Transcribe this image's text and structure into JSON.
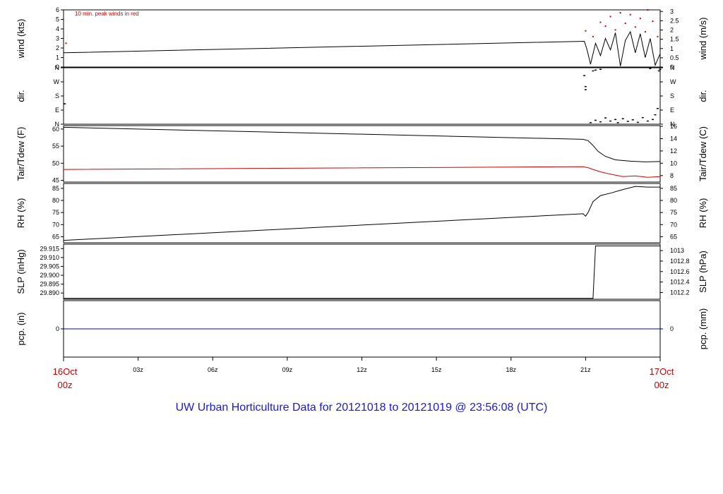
{
  "title": "UW Urban Horticulture Data for 20121018  to  20121019 @ 23:56:08  (UTC)",
  "colors": {
    "trace": "#000000",
    "red": "#cc0000",
    "blue": "#1a1ad6",
    "precip": "#0000cc"
  },
  "chart_data": {
    "type": "line",
    "x_axis": {
      "tick_labels": [
        "03z",
        "06z",
        "09z",
        "12z",
        "15z",
        "18z",
        "21z"
      ],
      "tick_hours": [
        3,
        6,
        9,
        12,
        15,
        18,
        21
      ],
      "start_label": [
        "16Oct",
        "00z"
      ],
      "end_label": [
        "17Oct",
        "00z"
      ],
      "range_hours": [
        0,
        24
      ]
    },
    "panels": [
      {
        "id": "wind",
        "left_label": "wind (kts)",
        "right_label": "wind (m/s)",
        "left_ticks": [
          "0",
          "1",
          "2",
          "3",
          "4",
          "5",
          "6"
        ],
        "left_tick_values": [
          0,
          1,
          2,
          3,
          4,
          5,
          6
        ],
        "right_ticks": [
          "0",
          "0.5",
          "1",
          "1.5",
          "2",
          "2.5",
          "3"
        ],
        "right_tick_values": [
          0,
          0.5,
          1,
          1.5,
          2,
          2.5,
          3
        ],
        "ylim": [
          0,
          6
        ],
        "annotation": "10 min. peak winds in red",
        "series": [
          {
            "style": "line",
            "color": "#000000",
            "points": [
              [
                0,
                1.5
              ],
              [
                20.95,
                2.7
              ],
              [
                21.05,
                1.9
              ],
              [
                21.2,
                0.3
              ],
              [
                21.4,
                2.5
              ],
              [
                21.6,
                1.2
              ],
              [
                21.8,
                3.0
              ],
              [
                22.0,
                1.8
              ],
              [
                22.2,
                3.6
              ],
              [
                22.4,
                0.1
              ],
              [
                22.6,
                2.8
              ],
              [
                22.8,
                3.7
              ],
              [
                23.0,
                1.5
              ],
              [
                23.2,
                3.5
              ],
              [
                23.4,
                1.0
              ],
              [
                23.6,
                3.0
              ],
              [
                23.8,
                0.2
              ],
              [
                24,
                1.4
              ]
            ]
          },
          {
            "style": "points",
            "color": "#cc0000",
            "points": [
              [
                0.1,
                2.5
              ],
              [
                21.0,
                3.8
              ],
              [
                21.3,
                3.2
              ],
              [
                21.6,
                4.7
              ],
              [
                21.8,
                4.3
              ],
              [
                22.0,
                5.3
              ],
              [
                22.2,
                3.9
              ],
              [
                22.4,
                5.7
              ],
              [
                22.6,
                4.6
              ],
              [
                22.8,
                5.5
              ],
              [
                23.0,
                4.2
              ],
              [
                23.2,
                5.1
              ],
              [
                23.4,
                3.7
              ],
              [
                23.5,
                6.0
              ],
              [
                23.7,
                4.8
              ],
              [
                23.9,
                3.2
              ]
            ]
          }
        ]
      },
      {
        "id": "dir",
        "left_label": "dir.",
        "right_label": "dir.",
        "left_ticks": [
          "N",
          "E",
          "S",
          "W",
          "N"
        ],
        "left_tick_values": [
          0,
          90,
          180,
          270,
          360
        ],
        "right_ticks": [
          "N",
          "E",
          "S",
          "W",
          "N"
        ],
        "right_tick_values": [
          0,
          90,
          180,
          270,
          360
        ],
        "ylim": [
          0,
          360
        ],
        "series": [
          {
            "style": "dashes",
            "color": "#000000",
            "points": [
              [
                0.05,
                130
              ],
              [
                20.95,
                310
              ],
              [
                21.0,
                240
              ],
              [
                21.0,
                220
              ],
              [
                21.3,
                340
              ],
              [
                21.4,
                345
              ],
              [
                21.6,
                350
              ],
              [
                21.2,
                10
              ],
              [
                21.4,
                25
              ],
              [
                21.6,
                15
              ],
              [
                21.8,
                40
              ],
              [
                22.0,
                20
              ],
              [
                22.2,
                30
              ],
              [
                22.3,
                10
              ],
              [
                22.5,
                35
              ],
              [
                22.7,
                18
              ],
              [
                22.9,
                28
              ],
              [
                23.1,
                12
              ],
              [
                23.3,
                42
              ],
              [
                23.5,
                20
              ],
              [
                23.6,
                355
              ],
              [
                23.7,
                30
              ],
              [
                23.8,
                60
              ],
              [
                23.9,
                100
              ],
              [
                23.95,
                340
              ],
              [
                24,
                350
              ]
            ]
          }
        ]
      },
      {
        "id": "temp",
        "left_label": "Tair/Tdew (F)",
        "right_label": "Tair/Tdew (C)",
        "left_ticks": [
          "45",
          "50",
          "55",
          "60"
        ],
        "left_tick_values": [
          45,
          50,
          55,
          60
        ],
        "right_ticks": [
          "8",
          "10",
          "12",
          "14",
          "16"
        ],
        "right_tick_values": [
          8,
          10,
          12,
          14,
          16
        ],
        "ylim": [
          44.5,
          61
        ],
        "series": [
          {
            "style": "line",
            "color": "#000000",
            "points": [
              [
                0,
                60.5
              ],
              [
                20.9,
                57
              ],
              [
                21.1,
                56.6
              ],
              [
                21.3,
                55.2
              ],
              [
                21.5,
                53.5
              ],
              [
                21.8,
                52.0
              ],
              [
                22.2,
                51.0
              ],
              [
                22.8,
                50.6
              ],
              [
                23.4,
                50.4
              ],
              [
                24,
                50.5
              ]
            ]
          },
          {
            "style": "line",
            "color": "#cc0000",
            "points": [
              [
                0,
                48.2
              ],
              [
                20.9,
                49.0
              ],
              [
                21.1,
                48.7
              ],
              [
                21.3,
                48.2
              ],
              [
                21.6,
                47.5
              ],
              [
                22.0,
                46.8
              ],
              [
                22.5,
                46.1
              ],
              [
                23.0,
                46.3
              ],
              [
                23.5,
                45.9
              ],
              [
                24,
                46.1
              ]
            ]
          }
        ]
      },
      {
        "id": "rh",
        "left_label": "RH (%)",
        "right_label": "RH (%)",
        "left_ticks": [
          "65",
          "70",
          "75",
          "80",
          "85"
        ],
        "left_tick_values": [
          65,
          70,
          75,
          80,
          85
        ],
        "right_ticks": [
          "65",
          "70",
          "75",
          "80",
          "85"
        ],
        "right_tick_values": [
          65,
          70,
          75,
          80,
          85
        ],
        "ylim": [
          62.5,
          87
        ],
        "series": [
          {
            "style": "line",
            "color": "#000000",
            "points": [
              [
                0,
                63.5
              ],
              [
                20.9,
                74.5
              ],
              [
                21.0,
                73.5
              ],
              [
                21.1,
                75.0
              ],
              [
                21.3,
                79.5
              ],
              [
                21.6,
                82.0
              ],
              [
                22.0,
                83.0
              ],
              [
                22.5,
                84.5
              ],
              [
                23.0,
                85.8
              ],
              [
                23.5,
                85.5
              ],
              [
                24,
                85.5
              ]
            ]
          }
        ]
      },
      {
        "id": "slp",
        "left_label": "SLP (inHg)",
        "right_label": "SLP (hPa)",
        "left_ticks": [
          "29.890",
          "29.895",
          "29.900",
          "29.905",
          "29.910",
          "29.915"
        ],
        "left_tick_values": [
          29.89,
          29.895,
          29.9,
          29.905,
          29.91,
          29.915
        ],
        "right_ticks": [
          "1012.2",
          "1012.4",
          "1012.6",
          "1012.8",
          "1013"
        ],
        "right_tick_values": [
          1012.2,
          1012.4,
          1012.6,
          1012.8,
          1013.0
        ],
        "ylim": [
          29.8865,
          29.9175
        ],
        "series": [
          {
            "style": "line",
            "color": "#000000",
            "points": [
              [
                0,
                29.887
              ],
              [
                21.3,
                29.887
              ],
              [
                21.4,
                29.9165
              ],
              [
                24,
                29.9165
              ]
            ]
          }
        ]
      },
      {
        "id": "pcp",
        "left_label": "pcp. (in)",
        "right_label": "pcp. (mm)",
        "left_ticks": [
          "0"
        ],
        "left_tick_values": [
          0
        ],
        "right_ticks": [
          "0"
        ],
        "right_tick_values": [
          0
        ],
        "ylim": [
          -1,
          1
        ],
        "series": [
          {
            "style": "line",
            "color": "#0000cc",
            "points": [
              [
                0,
                0
              ],
              [
                24,
                0
              ]
            ]
          }
        ]
      }
    ]
  }
}
